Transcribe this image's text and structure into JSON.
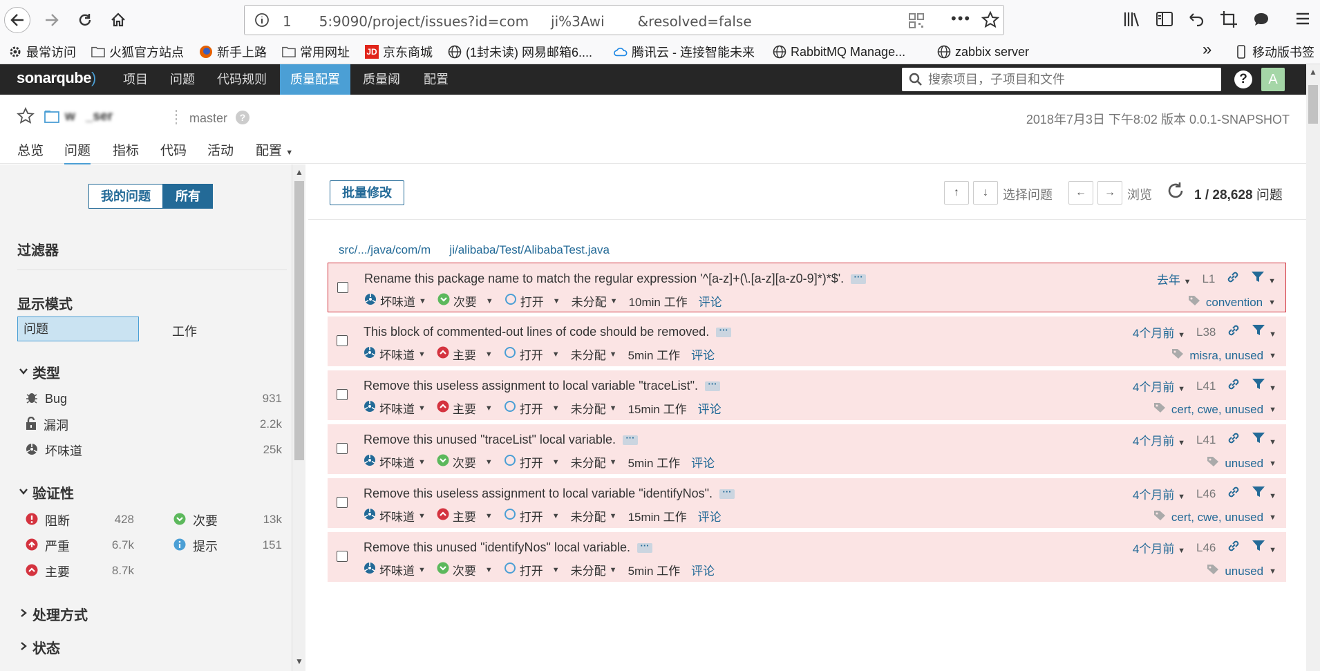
{
  "browser": {
    "url": "1          5:9090/project/issues?id=com        ji%3Awi            &resolved=false",
    "more": "•••"
  },
  "bookmarks": [
    {
      "label": "最常访问",
      "icon": "gear-icon"
    },
    {
      "label": "火狐官方站点",
      "icon": "folder-icon"
    },
    {
      "label": "新手上路",
      "icon": "firefox-icon"
    },
    {
      "label": "常用网址",
      "icon": "folder-icon"
    },
    {
      "label": "京东商城",
      "icon": "jd-icon"
    },
    {
      "label": "(1封未读) 网易邮箱6....",
      "icon": "globe-icon"
    },
    {
      "label": "腾讯云 - 连接智能未来",
      "icon": "cloud-icon"
    },
    {
      "label": "RabbitMQ Manage...",
      "icon": "globe-icon"
    },
    {
      "label": "zabbix server",
      "icon": "globe-icon"
    }
  ],
  "bookmarks_overflow": "»",
  "mobile_bookmarks": "移动版书签",
  "sonar": {
    "logo_text": "sonarqube",
    "nav": [
      "项目",
      "问题",
      "代码规则",
      "质量配置",
      "质量阈",
      "配置"
    ],
    "active_nav": "质量配置",
    "search_placeholder": "搜索项目，子项目和文件",
    "help": "?",
    "avatar": "A"
  },
  "project": {
    "name": "w    _ser    ",
    "branch": "master",
    "branch_help": "?",
    "meta": "2018年7月3日 下午8:02   版本 0.0.1-SNAPSHOT",
    "tabs": [
      "总览",
      "问题",
      "指标",
      "代码",
      "活动",
      "配置"
    ],
    "active_tab": "问题"
  },
  "sidebar": {
    "my_issues": "我的问题",
    "all": "所有",
    "filters_title": "过滤器",
    "display_mode_title": "显示模式",
    "mode_issues": "问题",
    "mode_effort": "工作",
    "type_section": "类型",
    "types": [
      {
        "label": "Bug",
        "count": "931",
        "icon": "bug-icon"
      },
      {
        "label": "漏洞",
        "count": "2.2k",
        "icon": "lock-icon"
      },
      {
        "label": "坏味道",
        "count": "25k",
        "icon": "code-smell-icon"
      }
    ],
    "severity_section": "验证性",
    "severities": [
      {
        "label": "阻断",
        "count": "428",
        "icon": "blocker-icon",
        "color": "#d4333f"
      },
      {
        "label": "次要",
        "count": "13k",
        "icon": "minor-icon",
        "color": "#5cb85c"
      },
      {
        "label": "严重",
        "count": "6.7k",
        "icon": "critical-icon",
        "color": "#d4333f"
      },
      {
        "label": "提示",
        "count": "151",
        "icon": "info-icon",
        "color": "#4b9fd5"
      },
      {
        "label": "主要",
        "count": "8.7k",
        "icon": "major-icon",
        "color": "#d4333f"
      }
    ],
    "resolution_section": "处理方式",
    "status_section": "状态"
  },
  "toolbar": {
    "bulk_change": "批量修改",
    "up": "↑",
    "down": "↓",
    "select_issue": "选择问题",
    "left": "←",
    "right": "→",
    "browse": "浏览",
    "count_current": "1 / 28,628",
    "count_suffix": "问题"
  },
  "file_path": "src/.../java/com/m        ji/alibaba/Test/AlibabaTest.java",
  "issues": [
    {
      "message": "Rename this package name to match the regular expression '^[a-z]+(\\.[a-z][a-z0-9]*)*$'.",
      "type": "坏味道",
      "severity": "次要",
      "severity_icon": "minor-icon",
      "status": "打开",
      "assignee": "未分配",
      "effort": "10min 工作",
      "comment": "评论",
      "age": "去年",
      "line": "L1",
      "tags": "convention"
    },
    {
      "message": "This block of commented-out lines of code should be removed.",
      "type": "坏味道",
      "severity": "主要",
      "severity_icon": "major-icon",
      "status": "打开",
      "assignee": "未分配",
      "effort": "5min 工作",
      "comment": "评论",
      "age": "4个月前",
      "line": "L38",
      "tags": "misra, unused"
    },
    {
      "message": "Remove this useless assignment to local variable \"traceList\".",
      "type": "坏味道",
      "severity": "主要",
      "severity_icon": "major-icon",
      "status": "打开",
      "assignee": "未分配",
      "effort": "15min 工作",
      "comment": "评论",
      "age": "4个月前",
      "line": "L41",
      "tags": "cert, cwe, unused"
    },
    {
      "message": "Remove this unused \"traceList\" local variable.",
      "type": "坏味道",
      "severity": "次要",
      "severity_icon": "minor-icon",
      "status": "打开",
      "assignee": "未分配",
      "effort": "5min 工作",
      "comment": "评论",
      "age": "4个月前",
      "line": "L41",
      "tags": "unused"
    },
    {
      "message": "Remove this useless assignment to local variable \"identifyNos\".",
      "type": "坏味道",
      "severity": "主要",
      "severity_icon": "major-icon",
      "status": "打开",
      "assignee": "未分配",
      "effort": "15min 工作",
      "comment": "评论",
      "age": "4个月前",
      "line": "L46",
      "tags": "cert, cwe, unused"
    },
    {
      "message": "Remove this unused \"identifyNos\" local variable.",
      "type": "坏味道",
      "severity": "次要",
      "severity_icon": "minor-icon",
      "status": "打开",
      "assignee": "未分配",
      "effort": "5min 工作",
      "comment": "评论",
      "age": "4个月前",
      "line": "L46",
      "tags": "unused"
    }
  ],
  "colors": {
    "accent": "#4b9fd5",
    "dark_blue": "#236a97",
    "issue_bg": "#fbe4e4",
    "selected_border": "#d02f3a",
    "minor": "#5cb85c",
    "major": "#d4333f"
  }
}
